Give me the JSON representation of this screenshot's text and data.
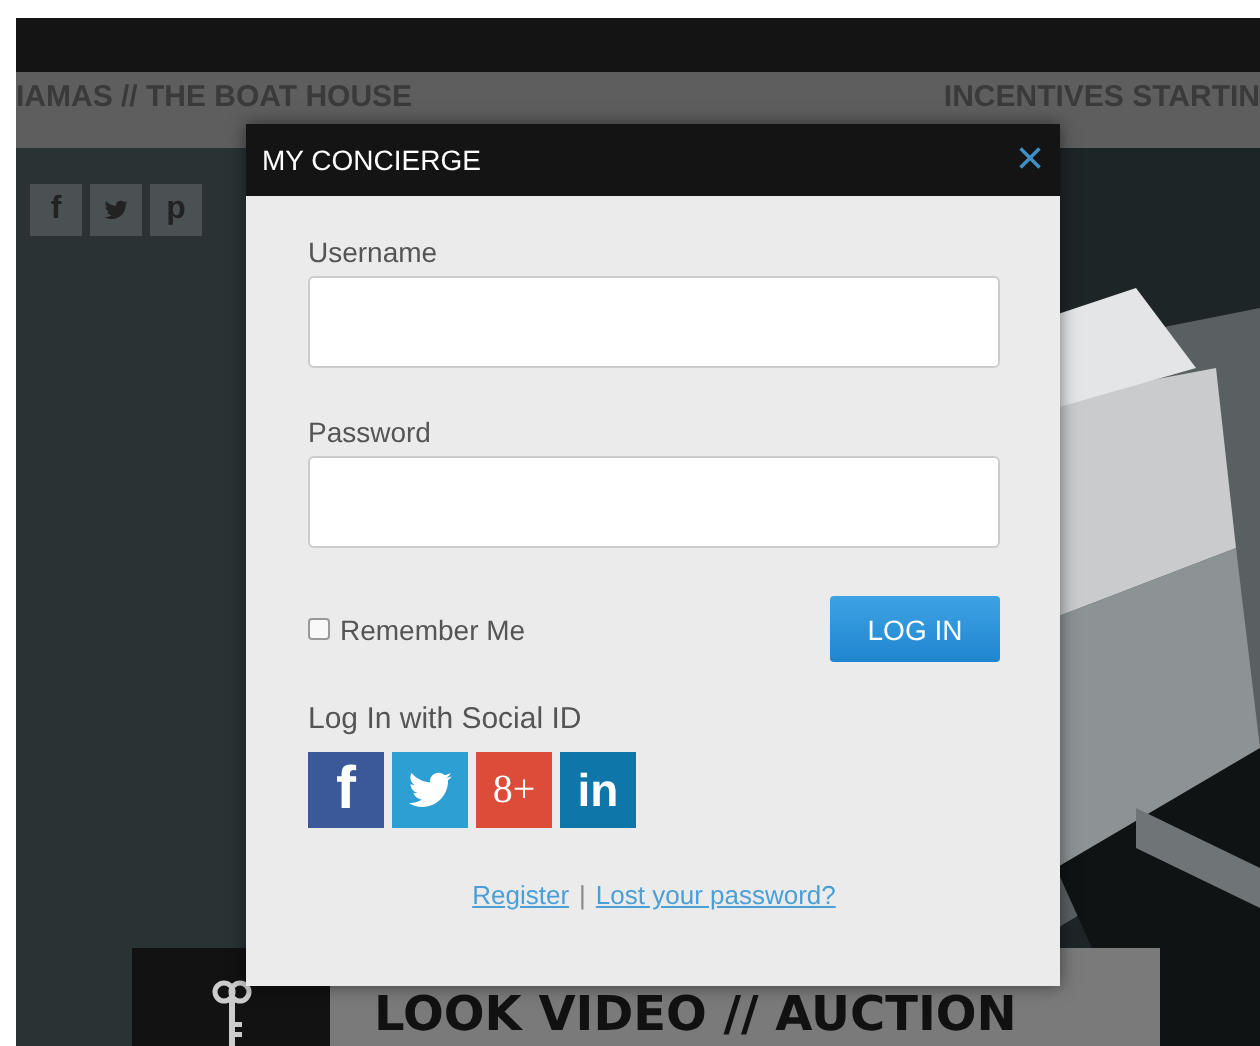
{
  "background": {
    "strip_left": "IAMAS // THE BOAT HOUSE",
    "strip_right": "INCENTIVES STARTIN",
    "share_icons": [
      {
        "kind": "facebook",
        "label": "f"
      },
      {
        "kind": "twitter"
      },
      {
        "kind": "pinterest",
        "label": "p"
      }
    ],
    "banner": "LOOK VIDEO // AUCTION"
  },
  "dialog": {
    "title": "MY CONCIERGE",
    "close": "×",
    "fields": [
      {
        "label": "Username"
      },
      {
        "label": "Password"
      }
    ],
    "remember": {
      "label": "Remember Me",
      "checked": false
    },
    "login_button": "LOG IN",
    "social_heading": "Log In with Social ID",
    "social_buttons": [
      {
        "kind": "facebook",
        "label": "f"
      },
      {
        "kind": "twitter"
      },
      {
        "kind": "google",
        "label": "8+"
      },
      {
        "kind": "linkedin",
        "label": "in"
      }
    ],
    "links": [
      "Register",
      "Lost your password?"
    ],
    "link_separator": "|"
  }
}
